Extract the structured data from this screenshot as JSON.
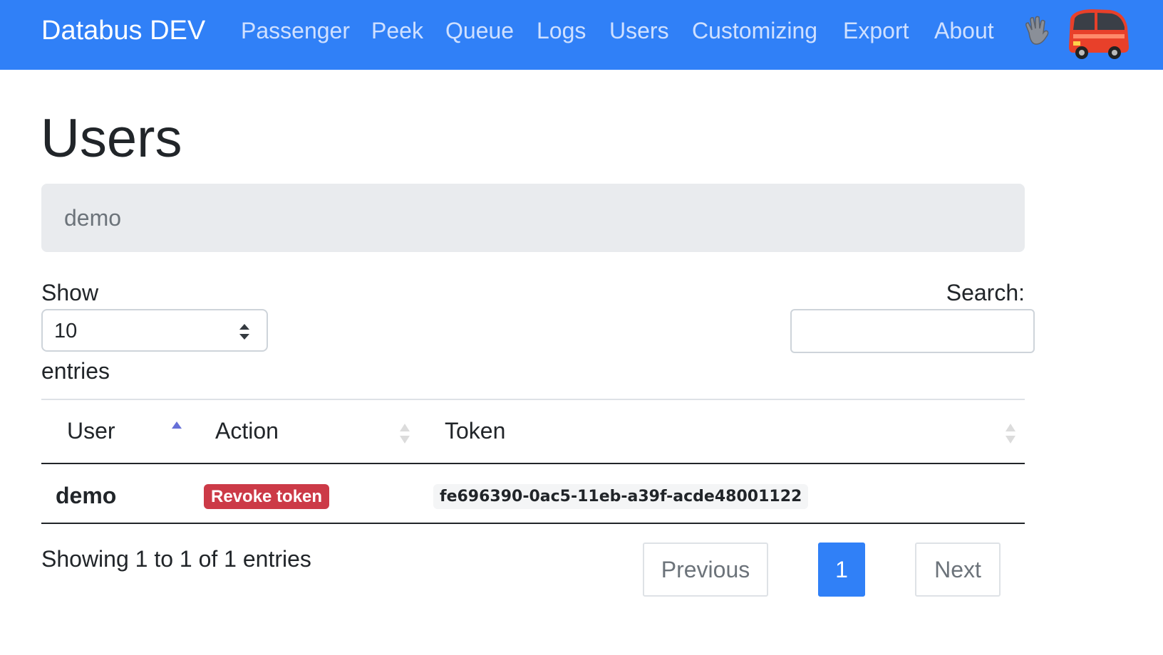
{
  "navbar": {
    "brand": "Databus DEV",
    "items": [
      "Passenger",
      "Peek",
      "Queue",
      "Logs",
      "Users",
      "Customizing",
      "Export",
      "About"
    ],
    "icons": [
      "waving-hand-icon",
      "bus-logo"
    ]
  },
  "page": {
    "title": "Users",
    "banner_text": "demo"
  },
  "table_controls": {
    "show_label": "Show",
    "length_value": "10",
    "entries_label": "entries",
    "search_label": "Search:",
    "search_value": ""
  },
  "table": {
    "columns": [
      "User",
      "Action",
      "Token"
    ],
    "sorted_column": "User",
    "sort_direction": "ascending",
    "rows": [
      {
        "user": "demo",
        "action": "Revoke token",
        "token": "fe696390-0ac5-11eb-a39f-acde48001122"
      }
    ]
  },
  "footer": {
    "info": "Showing 1 to 1 of 1 entries",
    "previous": "Previous",
    "current_page": "1",
    "next": "Next"
  },
  "colors": {
    "navbar": "#3080f7",
    "badge_danger": "#cc3a47",
    "sort_active": "#6670d8"
  }
}
